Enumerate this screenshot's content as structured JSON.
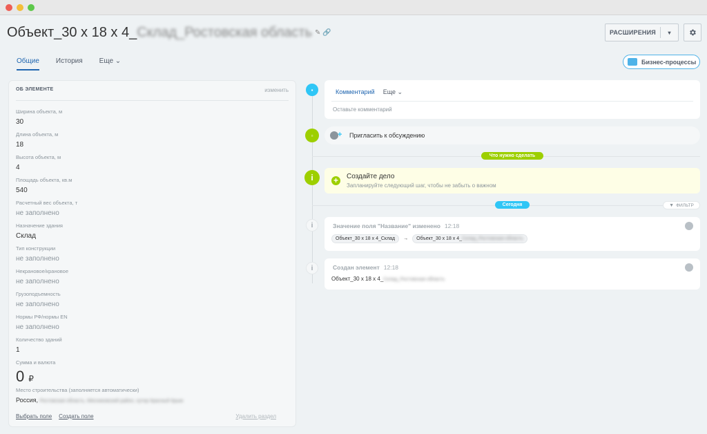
{
  "window": {
    "dots": [
      "#ee5e55",
      "#f4be3a",
      "#5dc84a"
    ]
  },
  "header": {
    "title_prefix": "Объект_30 x 18 x 4_",
    "title_blurred": "Склад_Ростовская область",
    "title_icons": "✎ 🔗",
    "extensions_label": "РАСШИРЕНИЯ",
    "extensions_arrow": "▾",
    "settings_icon": "gear-icon"
  },
  "tabs": [
    {
      "label": "Общие",
      "active": true
    },
    {
      "label": "История",
      "active": false
    },
    {
      "label": "Еще ⌄",
      "active": false
    }
  ],
  "business_processes_label": "Бизнес-процессы",
  "card": {
    "heading": "ОБ ЭЛЕМЕНТЕ",
    "edit_label": "изменить",
    "fields": [
      {
        "label": "Ширина объекта, м",
        "value": "30"
      },
      {
        "label": "Длина объекта, м",
        "value": "18"
      },
      {
        "label": "Высота объекта, м",
        "value": "4"
      },
      {
        "label": "Площадь объекта, кв.м",
        "value": "540"
      },
      {
        "label": "Расчетный вес объекта, т",
        "value": "не заполнено",
        "empty": true
      },
      {
        "label": "Назначение здания",
        "value": "Склад"
      },
      {
        "label": "Тип конструкции",
        "value": "не заполнено",
        "empty": true
      },
      {
        "label": "Некрановое/крановое",
        "value": "не заполнено",
        "empty": true
      },
      {
        "label": "Грузоподъемность",
        "value": "не заполнено",
        "empty": true
      },
      {
        "label": "Нормы РФ/нормы EN",
        "value": "не заполнено",
        "empty": true
      },
      {
        "label": "Количество зданий",
        "value": "1"
      }
    ],
    "money_label": "Сумма и валюта",
    "money_value": "0",
    "money_currency": "₽",
    "place_label": "Место строительства (заполняется автоматически)",
    "place_value": "Россия,",
    "place_blurred": "Ростовская область, Мясниковский район, хутор Красный Крым",
    "footer": {
      "select_field": "Выбрать поле",
      "create_field": "Создать поле",
      "delete_section": "Удалить раздел"
    }
  },
  "timeline": {
    "comment_tab": "Комментарий",
    "more_tab": "Еще ⌄",
    "comment_placeholder": "Оставьте комментарий",
    "invite_label": "Пригласить к обсуждению",
    "todo_pill": "Что нужно сделать",
    "task_title": "Создайте дело",
    "task_subtitle": "Запланируйте следующий шаг, чтобы не забыть о важном",
    "today_pill": "Сегодня",
    "filter_label": "ФИЛЬТР",
    "events": [
      {
        "title": "Значение поля \"Название\" изменено",
        "time": "12:18",
        "from": "Объект_30 x 18 x 4_Склад",
        "arrow": "→",
        "to_prefix": "Объект_30 x 18 x 4_",
        "to_blurred": "Склад_Ростовская область"
      },
      {
        "title": "Создан элемент",
        "time": "12:18",
        "value_prefix": "Объект_30 x 18 x 4_",
        "value_blurred": "Склад_Ростовская область"
      }
    ]
  },
  "colors": {
    "accent_blue": "#2fc6f6",
    "accent_green": "#9dcf00",
    "link_blue": "#2066b0"
  }
}
